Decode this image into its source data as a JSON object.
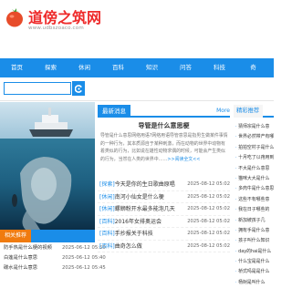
{
  "site": {
    "name": "道傍之筑网",
    "url": "www.udbszoaco.com"
  },
  "nav": [
    "首页",
    "探索",
    "休闲",
    "百科",
    "知识",
    "问答",
    "科技",
    "奇"
  ],
  "search": {
    "placeholder": ""
  },
  "related": {
    "heading": "相关推荐",
    "items": [
      {
        "text": "防手热是什么梗的视频",
        "date": "2025-06-12 05:50"
      },
      {
        "text": "白莲是什么意思",
        "date": "2025-06-12 05:40"
      },
      {
        "text": "碳水是什么意思",
        "date": "2025-06-12 05:45"
      }
    ]
  },
  "latest": {
    "heading": "最新消息",
    "more": "More",
    "featured_title": "导管是什么意思梗",
    "featured_body": "导管是什么意思网络用语?网络用语导管意思是指男生做某件事情的一种行为，其本质源自于某种刺激，而在动物的世界中动物有着类似的行为，比如说在雄性动物求偶的时候，可能会产生类似的行为，当然在人类的世界中……",
    "read_more": ">>阅读全文<<",
    "items": [
      {
        "tag": "[探索]",
        "text": "今天是你的生日歌曲原唱",
        "date": "2025-08-12 05:02"
      },
      {
        "tag": "[休闲]",
        "text": "南河小仙女是什么梗",
        "date": "2025-08-12 05:02"
      },
      {
        "tag": "[休闲]",
        "text": "螺蛳粉开水最多能泡几天",
        "date": "2025-08-12 05:02"
      },
      {
        "tag": "[百科]",
        "text": "2016年女排奥运会",
        "date": "2025-08-12 05:02"
      },
      {
        "tag": "[百科]",
        "text": "手抄报关于科技",
        "date": "2025-08-12 05:02"
      },
      {
        "tag": "[百科]",
        "text": "曲奇怎么做",
        "date": "2025-08-12 05:02"
      }
    ]
  },
  "featured": {
    "heading": "精彩推荐",
    "items": [
      "猜师宗是什么意",
      "世界必然带产有哪些",
      "拍拍空村子是什么",
      "十月吃了以孢用到",
      "不大是什么意思",
      "猫咪大大是什么",
      "多肉牛是什么意思",
      "这些不有哪些意",
      "我在日子哪些的",
      "新加坡孩子几",
      "拥有手是什么意",
      "孩子叫什么知识",
      "day的hai是什么",
      "什么宝是是什么",
      "桥式吗是是什么",
      "杨树是叫什么"
    ]
  },
  "colors": {
    "brand": "#1a8de8",
    "accent": "#f07b0f",
    "logo_red": "#ee2b2b"
  }
}
